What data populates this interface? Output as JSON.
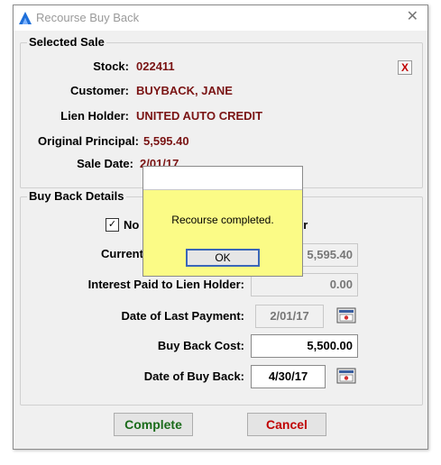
{
  "window": {
    "title": "Recourse Buy Back"
  },
  "selected_sale": {
    "legend": "Selected Sale",
    "stock_label": "Stock:",
    "stock_value": "022411",
    "customer_label": "Customer:",
    "customer_value": "BUYBACK, JANE",
    "lien_label": "Lien Holder:",
    "lien_value": "UNITED AUTO CREDIT",
    "principal_label": "Original Principal:",
    "principal_value": "5,595.40",
    "sale_date_label": "Sale Date:",
    "sale_date_value": "2/01/17",
    "remove_label": "X"
  },
  "buy_back": {
    "legend": "Buy Back Details",
    "checkbox_label_left": "No",
    "checkbox_label_right": "er",
    "checkbox_checked": true,
    "current_label": "Current",
    "current_value": "5,595.40",
    "interest_label": "Interest Paid to Lien Holder:",
    "interest_value": "0.00",
    "last_payment_label": "Date of Last Payment:",
    "last_payment_value": "2/01/17",
    "cost_label": "Buy Back Cost:",
    "cost_value": "5,500.00",
    "buyback_date_label": "Date of Buy Back:",
    "buyback_date_value": "4/30/17"
  },
  "buttons": {
    "complete": "Complete",
    "cancel": "Cancel"
  },
  "message": {
    "text": "Recourse completed.",
    "ok": "OK"
  },
  "colors": {
    "value_text": "#7a1414",
    "complete": "#1a6b1a",
    "cancel": "#c00000",
    "message_bg": "#fbfb86"
  }
}
